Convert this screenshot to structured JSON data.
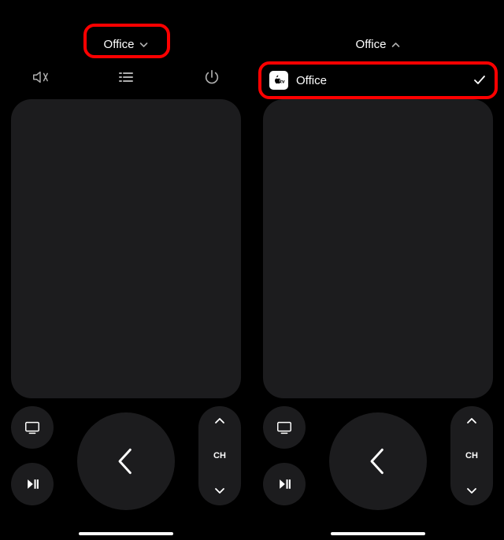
{
  "left": {
    "device_name": "Office",
    "channel_label": "CH"
  },
  "right": {
    "device_name": "Office",
    "channel_label": "CH",
    "dropdown": {
      "badge": "tv",
      "option_label": "Office"
    }
  }
}
